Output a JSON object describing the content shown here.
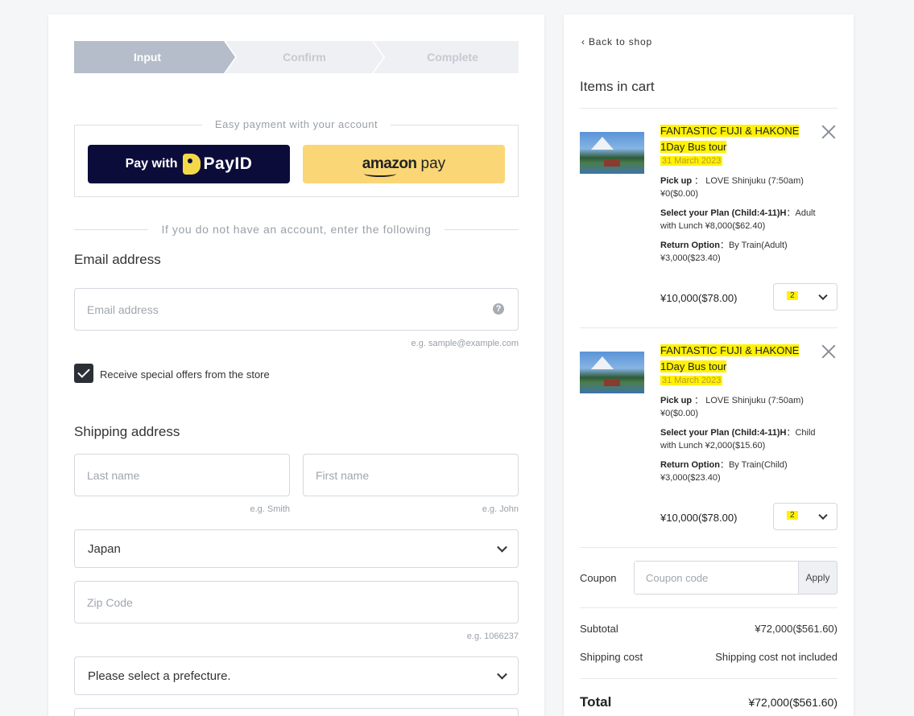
{
  "stepper": {
    "steps": [
      "Input",
      "Confirm",
      "Complete"
    ]
  },
  "easy_payment": {
    "legend": "Easy payment with your account",
    "payid_prefix": "Pay with",
    "payid_brand": "PayID",
    "amazon_brand": "amazon",
    "amazon_suffix": "pay"
  },
  "no_account_text": "If you do not have an account, enter the following",
  "email": {
    "title": "Email address",
    "placeholder": "Email address",
    "help": "?",
    "hint": "e.g. sample@example.com",
    "offers_label": "Receive special offers from the store"
  },
  "shipping": {
    "title": "Shipping address",
    "last_name_placeholder": "Last name",
    "last_name_hint": "e.g. Smith",
    "first_name_placeholder": "First name",
    "first_name_hint": "e.g. John",
    "country": "Japan",
    "zip_placeholder": "Zip Code",
    "zip_hint": "e.g. 1066237",
    "prefecture": "Please select a prefecture."
  },
  "cart": {
    "back_label": "Back to shop",
    "title": "Items in cart",
    "items": [
      {
        "name_line1": "FANTASTIC FUJI & HAKONE",
        "name_line2": "1Day Bus tour",
        "date": "31 March 2023",
        "pickup_label": "Pick up",
        "pickup_value": "LOVE Shinjuku (7:50am)",
        "pickup_price": "¥0($0.00)",
        "plan_label": "Select your Plan (Child:4-11)H",
        "plan_value": "Adult",
        "plan_line2": "with Lunch ¥8,000($62.40)",
        "return_label": "Return Option",
        "return_value": "By Train(Adult)",
        "return_price": "¥3,000($23.40)",
        "price": "¥10,000($78.00)",
        "qty": "2"
      },
      {
        "name_line1": "FANTASTIC FUJI & HAKONE",
        "name_line2": "1Day Bus tour",
        "date": "31 March 2023",
        "pickup_label": "Pick up",
        "pickup_value": "LOVE Shinjuku (7:50am)",
        "pickup_price": "¥0($0.00)",
        "plan_label": "Select your Plan (Child:4-11)H",
        "plan_value": "Child",
        "plan_line2": "with Lunch ¥2,000($15.60)",
        "return_label": "Return Option",
        "return_value": "By Train(Child)",
        "return_price": "¥3,000($23.40)",
        "price": "¥10,000($78.00)",
        "qty": "2"
      }
    ],
    "coupon_label": "Coupon",
    "coupon_placeholder": "Coupon code",
    "apply_label": "Apply",
    "subtotal_label": "Subtotal",
    "subtotal_value": "¥72,000($561.60)",
    "shipping_label": "Shipping cost",
    "shipping_value": "Shipping cost not included",
    "total_label": "Total",
    "total_value": "¥72,000($561.60)"
  },
  "colors": {
    "active_step": "#b4bdc9",
    "inactive_step": "#eef0f3",
    "payid_bg": "#0c0c3a",
    "amazon_bg": "#fad676",
    "highlight": "#fff200"
  }
}
